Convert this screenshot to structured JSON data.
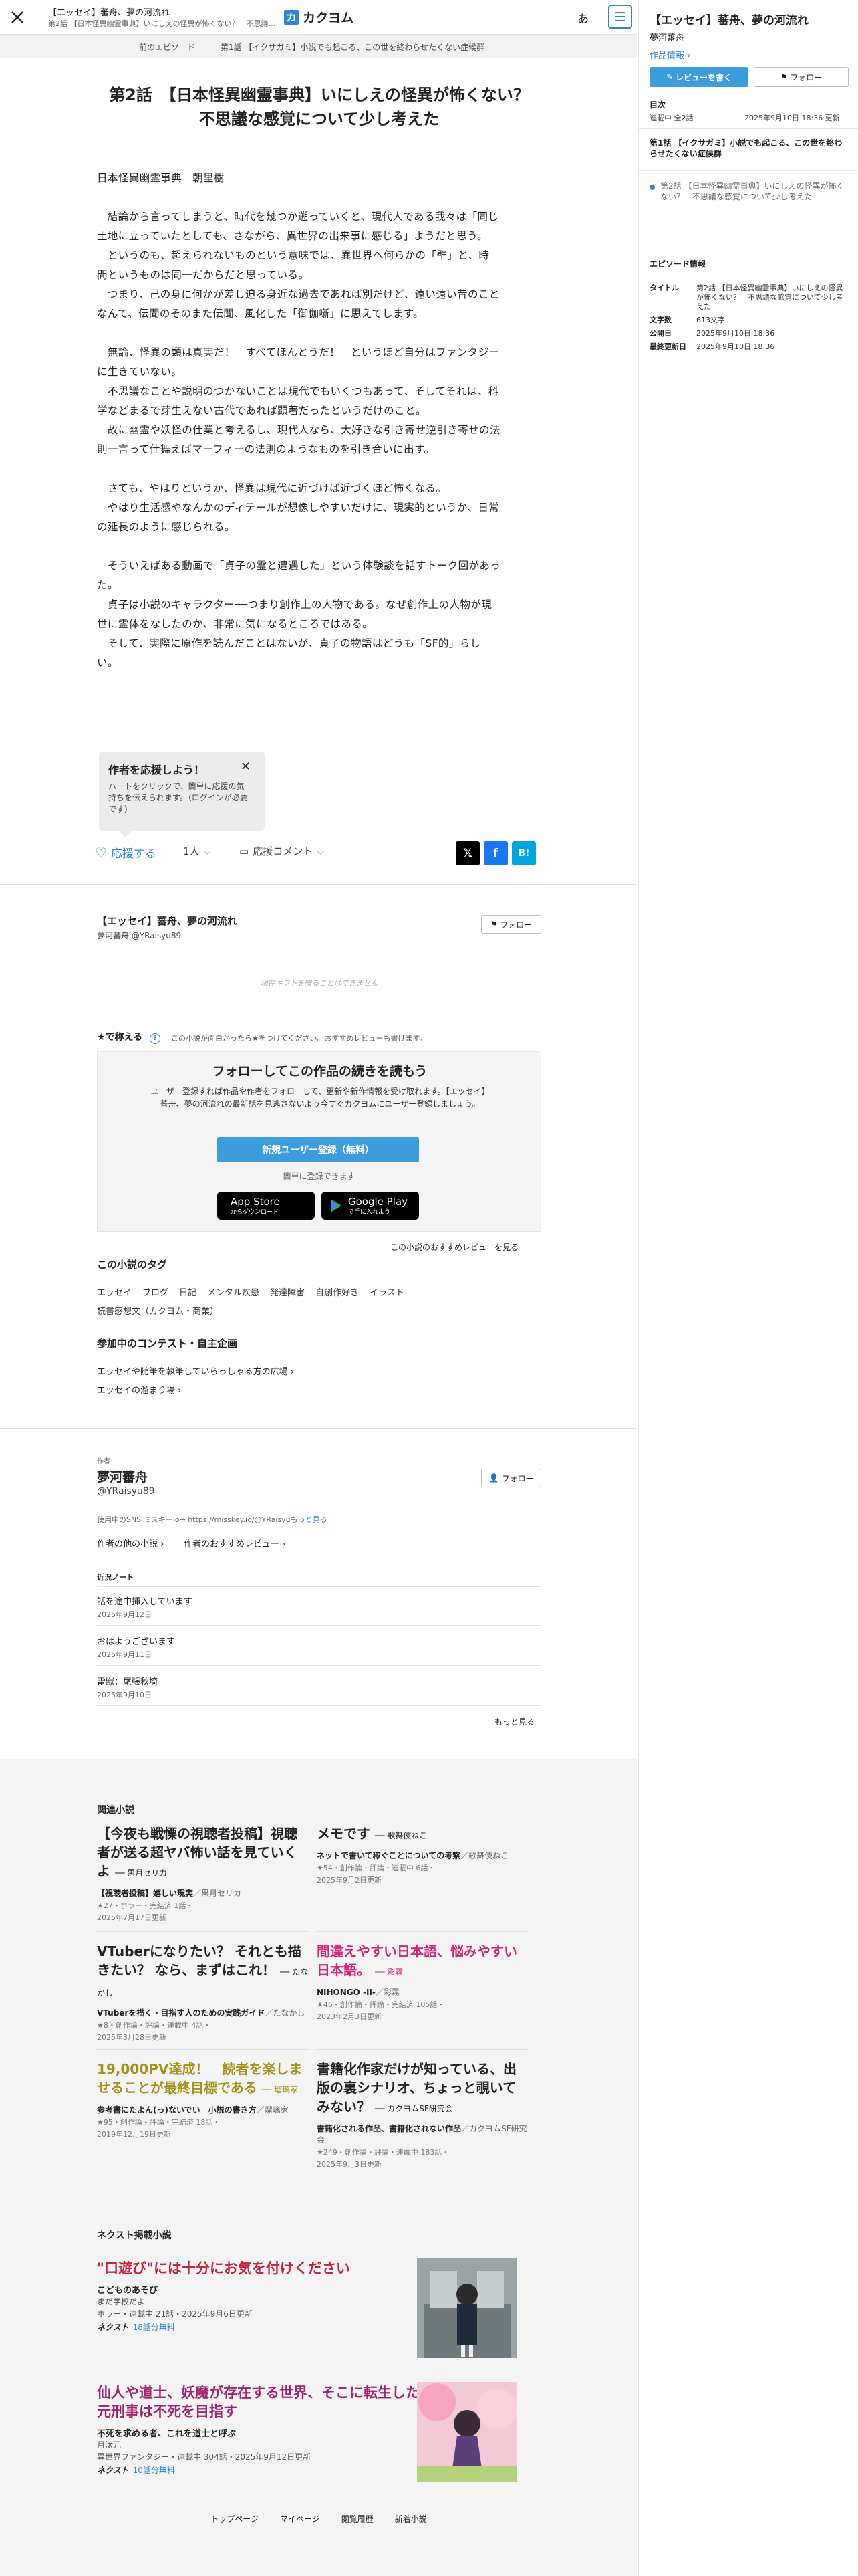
{
  "header": {
    "work_title": "【エッセイ】蕃舟、夢の河流れ",
    "episode_line": "第2話 【日本怪異幽霊事典】いにしえの怪異が怖くない？　不思議…",
    "logo_text": "カクヨム",
    "logo_mark": "カ",
    "font_button": "あ",
    "colors": {
      "accent": "#2f86d2",
      "nav_bg": "#f1f1f1"
    }
  },
  "episode_nav": {
    "prev_label": "前のエピソード",
    "current_label": "第1話 【イクサガミ】小説でも起こる、この世を終わらせたくない症候群"
  },
  "episode": {
    "title_line1": "第2話　【日本怪異幽霊事典】いにしえの怪異が怖くない？",
    "title_line2": "不思議な感覚について少し考えた",
    "body": [
      "日本怪異幽霊事典　朝里樹",
      "",
      "　結論から言ってしまうと、時代を幾つか遡っていくと、現代人である我々は「同じ",
      "土地に立っていたとしても、さながら、異世界の出来事に感じる」ようだと思う。",
      "　というのも、超えられないものという意味では、異世界へ何らかの「壁」と、時",
      "間というものは同一だからだと思っている。",
      "　つまり、己の身に何かが差し迫る身近な過去であれば別だけど、遠い遠い昔のこと",
      "なんて、伝聞のそのまた伝聞、風化した「御伽噺」に思えてします。",
      "",
      "　無論、怪異の類は真実だ！　すべてほんとうだ！　というほど自分はファンタジー",
      "に生きていない。",
      "　不思議なことや説明のつかないことは現代でもいくつもあって、そしてそれは、科",
      "学などまるで芽生えない古代であれば顕著だったというだけのこと。",
      "　故に幽霊や妖怪の仕業と考えるし、現代人なら、大好きな引き寄せ逆引き寄せの法",
      "則一言って仕舞えばマーフィーの法則のようなものを引き合いに出す。",
      "",
      "　さても、やはりというか、怪異は現代に近づけば近づくほど怖くなる。",
      "　やはり生活感やなんかのディテールが想像しやすいだけに、現実的というか、日常",
      "の延長のように感じられる。",
      "",
      "　そういえばある動画で「貞子の霊と遭遇した」という体験談を話すトーク回があっ",
      "た。",
      "　貞子は小説のキャラクター──つまり創作上の人物である。なぜ創作上の人物が現",
      "世に霊体をなしたのか、非常に気になるところではある。",
      "　そして、実際に原作を読んだことはないが、貞子の物語はどうも「SF的」らし",
      "い。"
    ]
  },
  "cheer_popup": {
    "heading": "作者を応援しよう！",
    "text": "ハートをクリックで、簡単に応援の気持ちを伝えられます。（ログインが必要です）"
  },
  "cheer_bar": {
    "cheer_label": "応援する",
    "cheer_count": "1人",
    "comment_label": "応援コメント",
    "share": {
      "x": "𝕏",
      "facebook": "f",
      "hatena": "B!"
    }
  },
  "work_block": {
    "title": "【エッセイ】蕃舟、夢の河流れ",
    "author": "夢河蕃舟 @YRaisyu89",
    "follow_label": "フォロー",
    "gift_note": "現在ギフトを贈ることはできません"
  },
  "rating": {
    "label": "★で称える",
    "help": "?",
    "note": "この小説が面白かったら★をつけてください。おすすめレビューも書けます。"
  },
  "follow_card": {
    "heading": "フォローしてこの作品の続きを読もう",
    "text": "ユーザー登録すれば作品や作者をフォローして、更新や新作情報を受け取れます。【エッセイ】蕃舟、夢の河流れの最新話を見逃さないよう今すぐカクヨムにユーザー登録しましょう。",
    "signup_button": "新規ユーザー登録（無料）",
    "easy_note": "簡単に登録できます",
    "appstore_small": "Download on the",
    "appstore_big": "App Store",
    "appstore_sub": "からダウンロード",
    "play_small": "GET IT ON",
    "play_big": "Google Play",
    "play_sub": "で手に入れよう"
  },
  "review_link": "この小説のおすすめレビューを見る",
  "tags": {
    "heading": "この小説のタグ",
    "items": [
      "エッセイ",
      "ブログ",
      "日記",
      "メンタル疾患",
      "発達障害",
      "自創作好き",
      "イラスト",
      "読書感想文（カクヨム・商業）"
    ]
  },
  "contests": {
    "heading": "参加中のコンテスト・自主企画",
    "items": [
      "エッセイや随筆を執筆していらっしゃる方の広場",
      "エッセイの溜まり場"
    ]
  },
  "author_block": {
    "caption": "作者",
    "name": "夢河蕃舟",
    "handle": "@YRaisyu89",
    "follow_label": "フォロー",
    "sns_note": "使用中のSNS ミスキーio→ https://misskey.io/@YRaisyu",
    "more_link": "もっと見る",
    "other_works": "作者の他の小説",
    "recommended": "作者のおすすめレビュー",
    "notes_heading": "近況ノート",
    "notes": [
      {
        "title": "話を途中挿入しています",
        "date": "2025年9月12日"
      },
      {
        "title": "おはようございます",
        "date": "2025年9月11日"
      },
      {
        "title": "雷獣：尾張秋埼",
        "date": "2025年9月10日"
      }
    ],
    "notes_more": "もっと見る"
  },
  "related": {
    "heading": "関連小説",
    "items": [
      {
        "title": "【今夜も戦慄の視聴者投稿】視聴者が送る超ヤバ怖い話を見ていくよ",
        "author_tag": "── 黒月セリカ",
        "sub": "【視聴者投稿】嬉しい現実",
        "sub_author": "／黒月セリカ",
        "meta1": "★27・ホラー・完結済 1話・",
        "meta2": "2025年7月17日更新",
        "color": "#222222"
      },
      {
        "title": "メモです",
        "author_tag": "── 歌舞伎ねこ",
        "sub": "ネットで書いて稼ぐことについての考察",
        "sub_author": "／歌舞伎ねこ",
        "meta1": "★54・創作論・評論・連載中 6話・",
        "meta2": "2025年9月2日更新",
        "color": "#222222"
      },
      {
        "title": "VTuberになりたい？ それとも描きたい？ なら、まずはこれ！",
        "author_tag": "── たなかし",
        "sub": "VTuberを描く・目指す人のための実践ガイド",
        "sub_author": "／たなかし",
        "meta1": "★8・創作論・評論・連載中 4話・",
        "meta2": "2025年3月28日更新",
        "color": "#222222"
      },
      {
        "title": "間違えやすい日本語、悩みやすい日本語。",
        "author_tag": "── 彩霧",
        "sub": "NIHONGO -II-",
        "sub_author": "／彩霧",
        "meta1": "★46・創作論・評論・完結済 105話・",
        "meta2": "2023年2月3日更新",
        "color": "#d4237a"
      },
      {
        "title": "19,000PV達成！　読者を楽しませることが最終目標である",
        "author_tag": "── 瑠璃家",
        "sub": "参考書にたよん(っ)ないでい　小説の書き方",
        "sub_author": "／瑠璃家",
        "meta1": "★95・創作論・評論・完結済 18話・",
        "meta2": "2019年12月19日更新",
        "color": "#a0921a"
      },
      {
        "title": "書籍化作家だけが知っている、出版の裏シナリオ、ちょっと覗いてみない？",
        "author_tag": "── カクヨムSF研究会",
        "sub": "書籍化される作品、書籍化されない作品",
        "sub_author": "／カクヨムSF研究会",
        "meta1": "★249・創作論・評論・連載中 183話・",
        "meta2": "2025年9月3日更新",
        "color": "#222222"
      }
    ]
  },
  "next": {
    "heading": "ネクスト掲載小説",
    "items": [
      {
        "title": "\"口遊び\"には十分にお気を付けください",
        "sub": "こどものあそび",
        "author": "まだ学校だよ",
        "meta": "ホラー・連載中 21話・2025年9月6日更新",
        "brand": "ネクスト",
        "free": "18話分無料",
        "color": "#c8213c"
      },
      {
        "title": "仙人や道士、妖魔が存在する世界、そこに転生した元刑事は不死を目指す",
        "sub": "不死を求める者、これを道士と呼ぶ",
        "author": "月汰元",
        "meta": "異世界ファンタジー・連載中 304話・2025年9月12日更新",
        "brand": "ネクスト",
        "free": "10話分無料",
        "color": "#a0236e"
      }
    ]
  },
  "footer_links": [
    "トップページ",
    "マイページ",
    "閲覧履歴",
    "新着小説"
  ],
  "sidebar": {
    "work_title": "【エッセイ】蕃舟、夢の河流れ",
    "author": "夢河蕃舟",
    "info_link": "作品情報",
    "review_button": "レビューを書く",
    "follow_button": "フォロー",
    "toc_heading": "目次",
    "status": "連載中 全2話",
    "updated": "2025年9月10日 18:36 更新",
    "toc_items": [
      "第1話 【イクサガミ】小説でも起こる、この世を終わらせたくない症候群",
      "第2話 【日本怪異幽霊事典】いにしえの怪異が怖くない？　不思議な感覚について少し考えた"
    ],
    "ep_info_heading": "エピソード情報",
    "ep_info": [
      {
        "k": "タイトル",
        "v": "第2話 【日本怪異幽霊事典】いにしえの怪異が怖くない？　不思議な感覚について少し考えた"
      },
      {
        "k": "文字数",
        "v": "613文字"
      },
      {
        "k": "公開日",
        "v": "2025年9月10日 18:36"
      },
      {
        "k": "最終更新日",
        "v": "2025年9月10日 18:36"
      }
    ]
  }
}
